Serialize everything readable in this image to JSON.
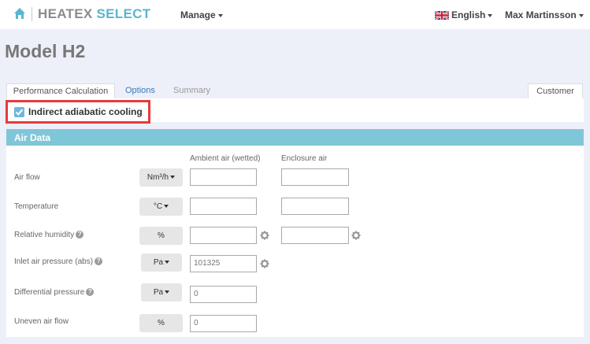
{
  "navbar": {
    "brand_a": "HEATEX",
    "brand_b": "SELECT",
    "manage": "Manage",
    "language": "English",
    "user": "Max Martinsson",
    "icons": [
      "home-icon",
      "uk-flag-icon"
    ]
  },
  "page": {
    "title": "Model H2"
  },
  "tabs": {
    "performance": "Performance Calculation",
    "options": "Options",
    "summary": "Summary",
    "customer": "Customer"
  },
  "indirect": {
    "label": "Indirect adiabatic cooling",
    "checked": true
  },
  "panel": {
    "title": "Air Data",
    "col_ambient": "Ambient air (wetted)",
    "col_enclosure": "Enclosure air",
    "rows": {
      "airflow": {
        "label": "Air flow",
        "unit": "Nm³/h",
        "ambient": "",
        "enclosure": ""
      },
      "temperature": {
        "label": "Temperature",
        "unit": "°C",
        "ambient": "",
        "enclosure": ""
      },
      "humidity": {
        "label": "Relative humidity",
        "unit": "%",
        "ambient": "",
        "enclosure": ""
      },
      "inlet_pressure": {
        "label": "Inlet air pressure (abs)",
        "unit": "Pa",
        "ambient": "101325"
      },
      "diff_pressure": {
        "label": "Differential pressure",
        "unit": "Pa",
        "ambient": "0"
      },
      "uneven": {
        "label": "Uneven air flow",
        "unit": "%",
        "ambient": "0"
      }
    }
  },
  "colors": {
    "accent": "#80c6d9",
    "brand_blue": "#5ab6cf",
    "highlight": "#e53b3b",
    "checkbox": "#6fb8dd"
  }
}
